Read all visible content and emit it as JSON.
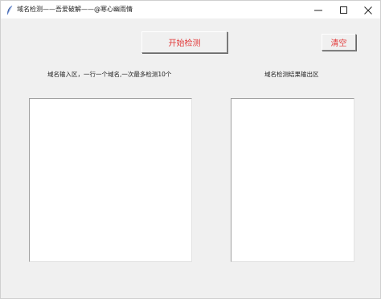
{
  "window": {
    "title": "域名检测——吾爱破解——@寒心幽雨情",
    "icons": {
      "app": "feather-icon",
      "minimize": "minimize-icon",
      "maximize": "maximize-icon",
      "close": "close-icon"
    }
  },
  "toolbar": {
    "start_label": "开始检测",
    "clear_label": "清空"
  },
  "input_panel": {
    "label": "域名输入区，一行一个域名,一次最多检测10个",
    "value": ""
  },
  "output_panel": {
    "label": "域名检测结果输出区",
    "value": ""
  },
  "colors": {
    "button_text": "#e23a3a",
    "background": "#f0f0f0",
    "titlebar": "#ffffff"
  }
}
